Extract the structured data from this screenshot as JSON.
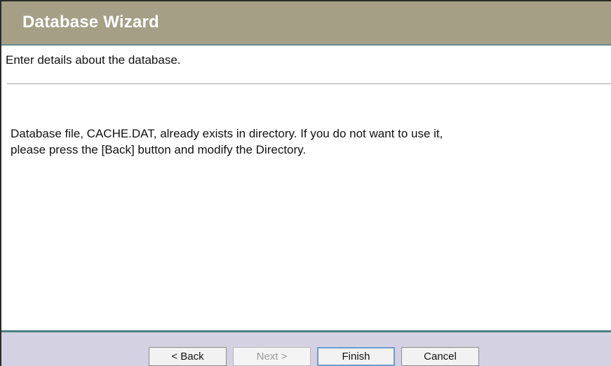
{
  "window": {
    "title": "Database Wizard"
  },
  "content": {
    "subtitle": "Enter details about the database.",
    "message_line1": "Database file, CACHE.DAT, already exists in directory. If you do not want to use it,",
    "message_line2": "please press the [Back] button and modify the Directory."
  },
  "buttons": {
    "back": "< Back",
    "next": "Next >",
    "finish": "Finish",
    "cancel": "Cancel"
  },
  "colors": {
    "title_bar": "#a59f86",
    "footer": "#d4d2e2",
    "accent_line": "#4d7f82",
    "finish_focus_border": "#6a9bd0"
  }
}
